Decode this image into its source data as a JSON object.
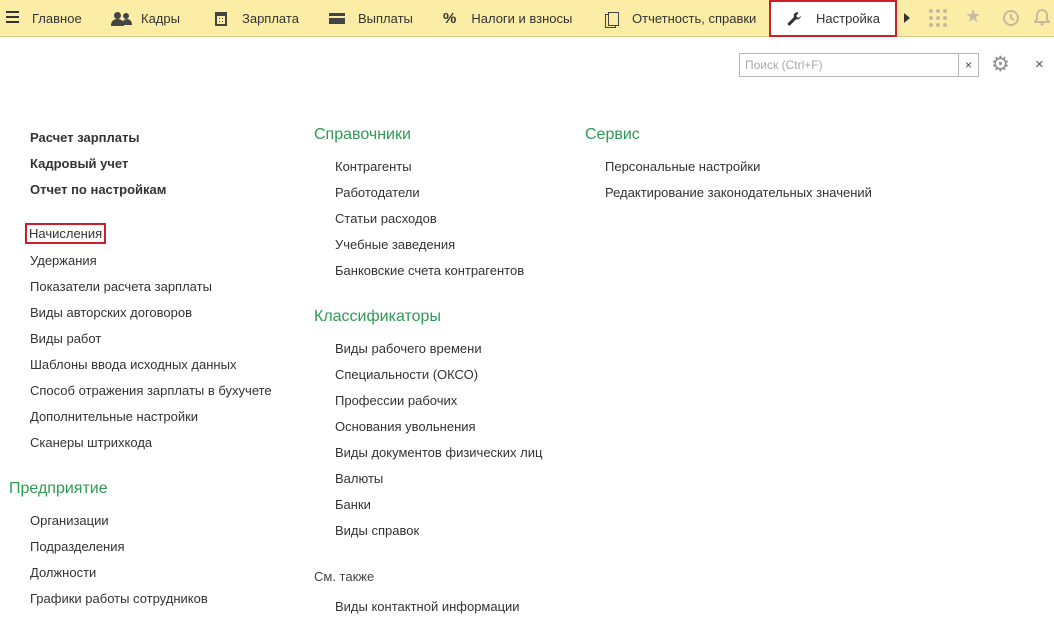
{
  "topbar": {
    "sections": [
      {
        "label": "Главное"
      },
      {
        "label": "Кадры"
      },
      {
        "label": "Зарплата"
      },
      {
        "label": "Выплаты"
      },
      {
        "label": "Налоги и взносы"
      },
      {
        "label": "Отчетность, справки"
      },
      {
        "label": "Настройка",
        "active": true
      }
    ],
    "icons": [
      "menu-icon",
      "users-icon",
      "calculator-icon",
      "card-icon",
      "percent-icon",
      "documents-icon",
      "wrench-icon",
      "more-arrow-icon",
      "apps-grid-icon",
      "star-icon",
      "history-icon",
      "bell-icon"
    ]
  },
  "search": {
    "placeholder": "Поиск (Ctrl+F)",
    "value": "",
    "clear_label": "×"
  },
  "window": {
    "close_label": "×"
  },
  "columns": {
    "left": {
      "bold_items": [
        "Расчет зарплаты",
        "Кадровый учет",
        "Отчет по настройкам"
      ],
      "items": [
        "Начисления",
        "Удержания",
        "Показатели расчета зарплаты",
        "Виды авторских договоров",
        "Виды работ",
        "Шаблоны ввода исходных данных",
        "Способ отражения зарплаты в бухучете",
        "Дополнительные настройки",
        "Сканеры штрихкода"
      ],
      "highlighted": "Начисления",
      "enterprise": {
        "title": "Предприятие",
        "items": [
          "Организации",
          "Подразделения",
          "Должности",
          "Графики работы сотрудников"
        ]
      }
    },
    "middle": {
      "references": {
        "title": "Справочники",
        "items": [
          "Контрагенты",
          "Работодатели",
          "Статьи расходов",
          "Учебные заведения",
          "Банковские счета контрагентов"
        ]
      },
      "classifiers": {
        "title": "Классификаторы",
        "items": [
          "Виды рабочего времени",
          "Специальности (ОКСО)",
          "Профессии рабочих",
          "Основания увольнения",
          "Виды документов физических лиц",
          "Валюты",
          "Банки",
          "Виды справок"
        ]
      },
      "see_also": {
        "title": "См. также",
        "items": [
          "Виды контактной информации"
        ]
      }
    },
    "right": {
      "service": {
        "title": "Сервис",
        "items": [
          "Персональные настройки",
          "Редактирование законодательных значений"
        ]
      }
    }
  },
  "colors": {
    "topbar_bg": "#fbeda5",
    "group_title": "#2f9a53",
    "highlight_border": "#cc1f2c"
  }
}
